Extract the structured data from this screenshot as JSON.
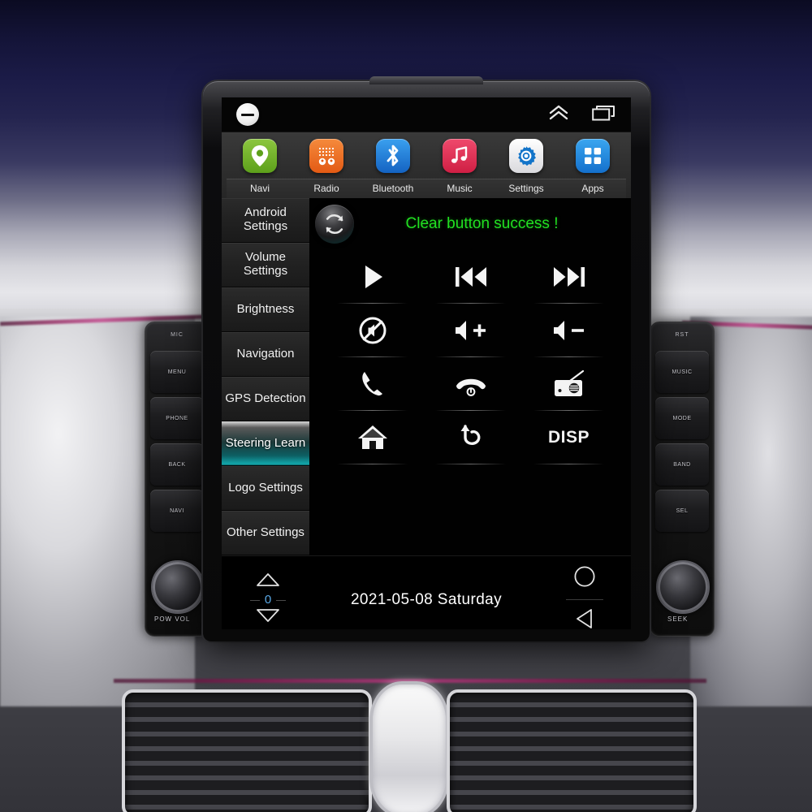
{
  "device": {
    "name": "car-head-unit",
    "left_panel": {
      "top_label": "MIC",
      "buttons": [
        "MENU",
        "PHONE",
        "BACK",
        "NAVI"
      ],
      "knob_label": "POW VOL"
    },
    "right_panel": {
      "top_label": "RST",
      "buttons": [
        "MUSIC",
        "MODE",
        "BAND",
        "SEL"
      ],
      "knob_label": "SEEK"
    }
  },
  "statusbar": {
    "minimize_icon": "minus-circle-icon",
    "collapse_icon": "double-chevron-up-icon",
    "recents_icon": "recent-apps-icon"
  },
  "dock": {
    "apps": [
      {
        "label": "Navi",
        "icon": "location-pin-icon",
        "color": "#6ab023"
      },
      {
        "label": "Radio",
        "icon": "radio-icon",
        "color": "#e8641c"
      },
      {
        "label": "Bluetooth",
        "icon": "bluetooth-icon",
        "color": "#1b82d8"
      },
      {
        "label": "Music",
        "icon": "music-note-icon",
        "color": "#e23155"
      },
      {
        "label": "Settings",
        "icon": "gear-icon",
        "color": "#f0f0f0"
      },
      {
        "label": "Apps",
        "icon": "grid-apps-icon",
        "color": "#1f8ae0"
      }
    ]
  },
  "sidebar": {
    "items": [
      {
        "label": "Android Settings",
        "active": false
      },
      {
        "label": "Volume Settings",
        "active": false
      },
      {
        "label": "Brightness",
        "active": false
      },
      {
        "label": "Navigation",
        "active": false
      },
      {
        "label": "GPS Detection",
        "active": false
      },
      {
        "label": "Steering Learn",
        "active": true
      },
      {
        "label": "Logo Settings",
        "active": false
      },
      {
        "label": "Other Settings",
        "active": false
      }
    ]
  },
  "main": {
    "sync_button_icon": "refresh-sync-icon",
    "toast_message": "Clear button success !",
    "toast_color": "#22e022",
    "buttons": [
      {
        "icon": "play-icon",
        "label": ""
      },
      {
        "icon": "previous-track-icon",
        "label": ""
      },
      {
        "icon": "next-track-icon",
        "label": ""
      },
      {
        "icon": "mute-icon",
        "label": ""
      },
      {
        "icon": "volume-up-icon",
        "label": ""
      },
      {
        "icon": "volume-down-icon",
        "label": ""
      },
      {
        "icon": "phone-answer-icon",
        "label": ""
      },
      {
        "icon": "phone-hangup-icon",
        "label": ""
      },
      {
        "icon": "radio-tuner-icon",
        "label": ""
      },
      {
        "icon": "home-icon",
        "label": ""
      },
      {
        "icon": "back-arrow-icon",
        "label": ""
      },
      {
        "icon": "text-label",
        "label": "DISP"
      }
    ]
  },
  "bottombar": {
    "step_up_icon": "triangle-up-icon",
    "step_value": "0",
    "step_down_icon": "triangle-down-icon",
    "datetime": "2021-05-08  Saturday",
    "circle_icon": "circle-home-icon",
    "back_icon": "triangle-left-icon"
  }
}
